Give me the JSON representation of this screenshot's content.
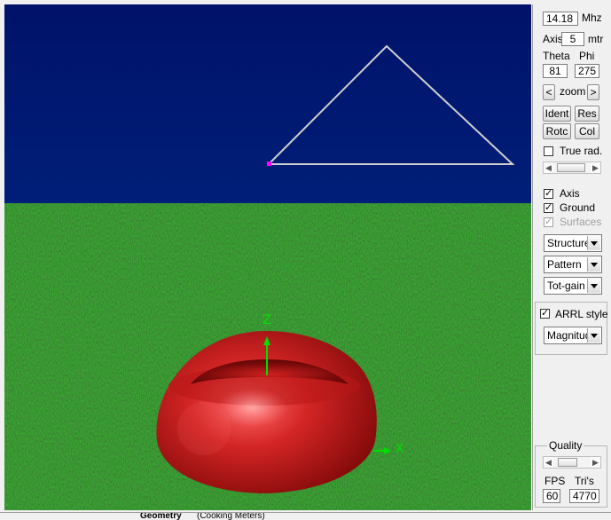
{
  "frequency": {
    "value": "14.18",
    "unit": "Mhz"
  },
  "axis": {
    "label": "Axis",
    "value": "5",
    "unit": "mtr"
  },
  "view": {
    "theta_label": "Theta",
    "phi_label": "Phi",
    "theta_value": "81",
    "phi_value": "275",
    "zoom_left": "<",
    "zoom_label": "zoom",
    "zoom_right": ">"
  },
  "buttons": {
    "ident": "Ident",
    "res": "Res",
    "rotc": "Rotc",
    "col": "Col"
  },
  "true_rad": {
    "label": "True rad.",
    "checked": false
  },
  "options": {
    "axis_label": "Axis",
    "axis_checked": true,
    "ground_label": "Ground",
    "ground_checked": true,
    "surfaces_label": "Surfaces",
    "surfaces_checked": true,
    "surfaces_enabled": false
  },
  "dropdowns": {
    "structure": "Structure",
    "pattern": "Pattern",
    "gain": "Tot-gain"
  },
  "arrl": {
    "label": "ARRL style",
    "checked": true,
    "mode": "Magnitude"
  },
  "quality": {
    "label": "Quality",
    "fps_label": "FPS",
    "tris_label": "Tri's",
    "fps_value": "60",
    "tris_value": "4770"
  },
  "viewport_axes": {
    "z": "Z",
    "x": "X"
  },
  "colors": {
    "sky": "#001a6e",
    "ground": "#1e5a1c",
    "pattern": "#c91e1e",
    "axis": "#00e000",
    "wire": "#d0d0d0"
  },
  "statusbar": {
    "text1": "Geometry",
    "text2": "(Cooking Meters)"
  }
}
